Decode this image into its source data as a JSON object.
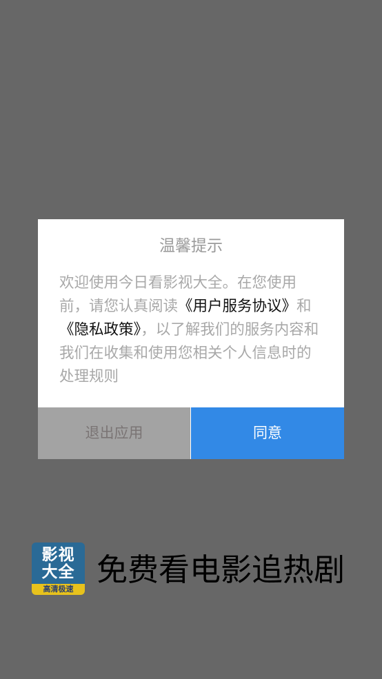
{
  "dialog": {
    "title": "温馨提示",
    "body_parts": {
      "part1": "欢迎使用今日看影视大全。在您使用前，请您认真阅读",
      "link1": "《用户服务协议》",
      "part2": "和",
      "link2": "《隐私政策》",
      "part3": "，以了解我们的服务内容和我们在收集和使用您相关个人信息时的处理规则"
    },
    "exit_label": "退出应用",
    "agree_label": "同意"
  },
  "app_logo": {
    "main_text": "影视大全",
    "band_text": "高清极速"
  },
  "slogan": "免费看电影追热剧",
  "colors": {
    "overlay": "#676767",
    "agree_button": "#3289e6",
    "exit_button": "#a3a3a3",
    "logo_blue": "#2a6a96",
    "logo_yellow": "#e8c21c"
  }
}
